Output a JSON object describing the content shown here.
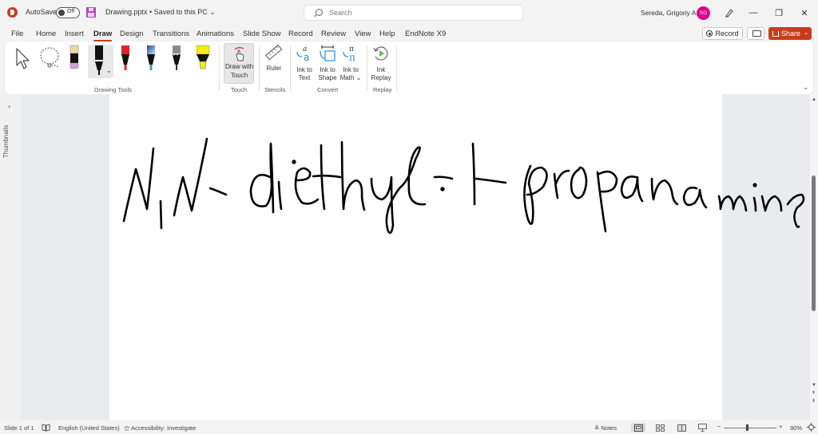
{
  "titlebar": {
    "autosave_label": "AutoSave",
    "autosave_state": "Off",
    "document_title": "Drawing.pptx • Saved to this PC",
    "title_chevron": "⌄",
    "search_placeholder": "Search",
    "user_name": "Sereda, Grigoriy A",
    "user_initials": "SG",
    "minimize": "—",
    "restore": "❐",
    "close": "✕"
  },
  "tabs": [
    "File",
    "Home",
    "Insert",
    "Draw",
    "Design",
    "Transitions",
    "Animations",
    "Slide Show",
    "Record",
    "Review",
    "View",
    "Help",
    "EndNote X9"
  ],
  "active_tab": "Draw",
  "actions": {
    "record_label": "Record",
    "share_label": "Share",
    "share_chevron": "⌄"
  },
  "ribbon": {
    "groups": {
      "drawing_tools": "Drawing Tools",
      "touch": "Touch",
      "stencils": "Stencils",
      "convert": "Convert",
      "replay": "Replay"
    },
    "pens": [
      {
        "name": "eraser",
        "colors": [
          "#f2d79b",
          "#111111",
          "#d69be0"
        ]
      },
      {
        "name": "pen-black",
        "color": "#111111",
        "selected": true
      },
      {
        "name": "pen-red",
        "color": "#e0202a"
      },
      {
        "name": "pen-galaxy",
        "color": "#5a6fb0",
        "tip": "#3aa3a8"
      },
      {
        "name": "pencil-gray",
        "color": "#8a8a8a"
      },
      {
        "name": "highlighter-yellow",
        "color": "#f5ea14"
      }
    ],
    "buttons": {
      "draw_with_touch": [
        "Draw with",
        "Touch"
      ],
      "ruler": "Ruler",
      "ink_to_text": [
        "Ink to",
        "Text"
      ],
      "ink_to_shape": [
        "Ink to",
        "Shape"
      ],
      "ink_to_math": [
        "Ink to",
        "Math ⌄"
      ],
      "ink_replay": [
        "Ink",
        "Replay"
      ]
    }
  },
  "sidebar": {
    "thumbnails_label": "Thumbnails",
    "expand_chevron": "›"
  },
  "slide": {
    "ink_text": "N,N-diethyl-1-propanamine",
    "ink_color": "#000000"
  },
  "statusbar": {
    "slide_counter": "Slide 1 of 1",
    "language": "English (United States)",
    "accessibility": "Accessibility: Investigate",
    "notes_label": "Notes",
    "zoom_minus": "−",
    "zoom_plus": "+",
    "zoom_level": "90%"
  },
  "colors": {
    "accent": "#c43e1c",
    "avatar": "#e3008c"
  }
}
